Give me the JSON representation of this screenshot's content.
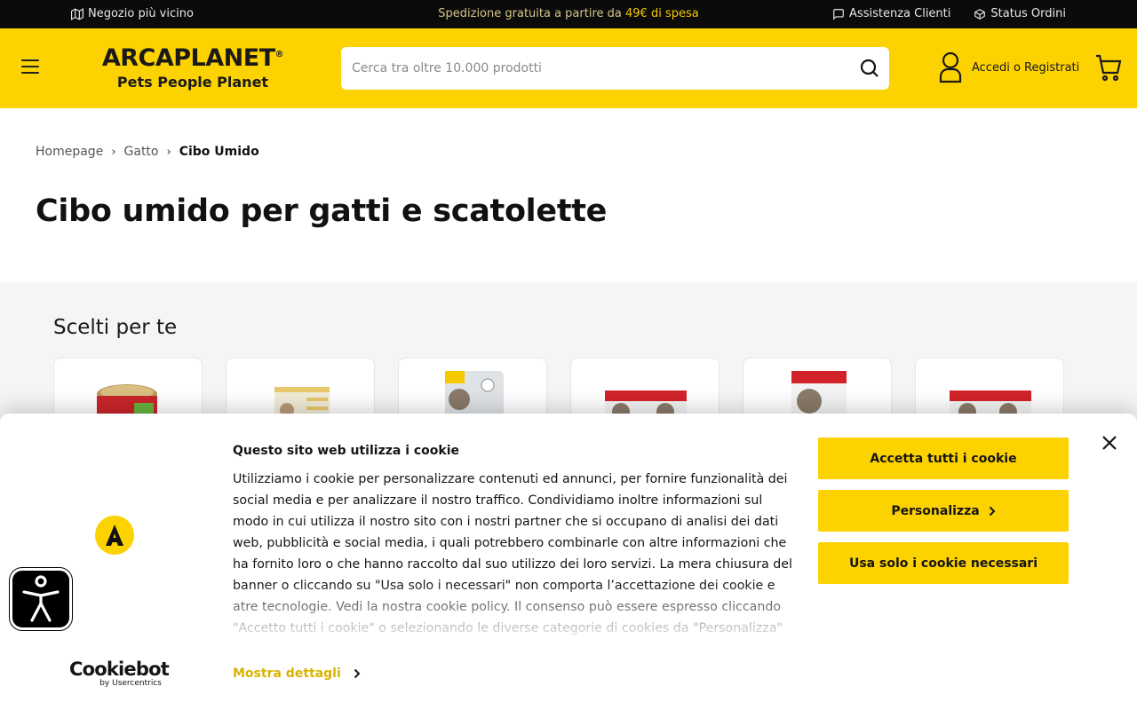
{
  "topbar": {
    "store_locator": "Negozio più vicino",
    "shipping_prefix": "Spedizione gratuita a partire da",
    "shipping_amount": "49€ di spesa",
    "customer_service": "Assistenza Clienti",
    "order_status": "Status Ordini"
  },
  "header": {
    "brand": "ARCAPLANET",
    "brand_mark": "®",
    "tagline": "Pets People Planet",
    "search_placeholder": "Cerca tra oltre 10.000 prodotti",
    "account_label": "Accedi o Registrati",
    "accent_color": "#fcd200"
  },
  "breadcrumb": {
    "items": [
      "Homepage",
      "Gatto"
    ],
    "separator": "›",
    "current": "Cibo Umido"
  },
  "page_title": "Cibo umido per gatti e scatolette",
  "recommended": {
    "heading": "Scelti per te",
    "products": [
      {
        "icon": "wet-food-can-image"
      },
      {
        "icon": "wet-food-multipack-image"
      },
      {
        "icon": "hills-sterilised-cat-pouch-image"
      },
      {
        "icon": "hills-multipack-pink-image"
      },
      {
        "icon": "hills-adult-cat-box-image"
      },
      {
        "icon": "hills-multipack-red-image"
      }
    ]
  },
  "cookie_banner": {
    "title": "Questo sito web utilizza i cookie",
    "body": "Utilizziamo i cookie per personalizzare contenuti ed annunci, per fornire funzionalità dei social media e per analizzare il nostro traffico. Condividiamo inoltre informazioni sul modo in cui utilizza il nostro sito con i nostri partner che si occupano di analisi dei dati web, pubblicità e social media, i quali potrebbero combinarle con altre informazioni che ha fornito loro o che hanno raccolto dal suo utilizzo dei loro servizi. La mera chiusura del banner o cliccando su \"Usa solo i necessari\" non comporta l’accettazione dei cookie e atre tecnologie. Vedi la nostra cookie policy. Il consenso può essere espresso cliccando \"Accetto tutti i cookie\" o selezionando le diverse categorie di cookies da \"Personalizza\"",
    "show_details": "Mostra dettagli",
    "accept_all": "Accetta tutti i cookie",
    "customize": "Personalizza",
    "necessary_only": "Usa solo i cookie necessari",
    "provider_name": "Cookiebot",
    "provider_by": "by Usercentrics"
  }
}
